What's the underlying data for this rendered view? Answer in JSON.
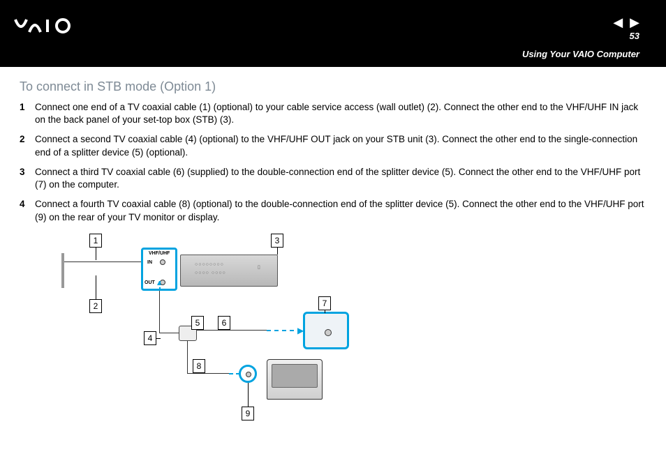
{
  "header": {
    "logo_text": "VAIO",
    "page_number": "53",
    "chapter": "Using Your VAIO Computer"
  },
  "section_title": "To connect in STB mode (Option 1)",
  "steps": [
    "Connect one end of a TV coaxial cable (1) (optional) to your cable service access (wall outlet) (2). Connect the other end to the VHF/UHF IN jack on the back panel of your set-top box (STB) (3).",
    "Connect a second TV coaxial cable (4) (optional) to the VHF/UHF OUT jack on your STB unit (3). Connect the other end to the single-connection end of a splitter device (5) (optional).",
    "Connect a third TV coaxial cable (6) (supplied) to the double-connection end of the splitter device (5). Connect the other end to the VHF/UHF port (7) on the computer.",
    "Connect a fourth TV coaxial cable (8) (optional) to the double-connection end of the splitter device (5). Connect the other end to the VHF/UHF port (9) on the rear of your TV monitor or display."
  ],
  "diagram": {
    "callouts": [
      "1",
      "2",
      "3",
      "4",
      "5",
      "6",
      "7",
      "8",
      "9"
    ],
    "stb_labels": {
      "group": "VHF/UHF",
      "in": "IN",
      "out": "OUT"
    }
  }
}
